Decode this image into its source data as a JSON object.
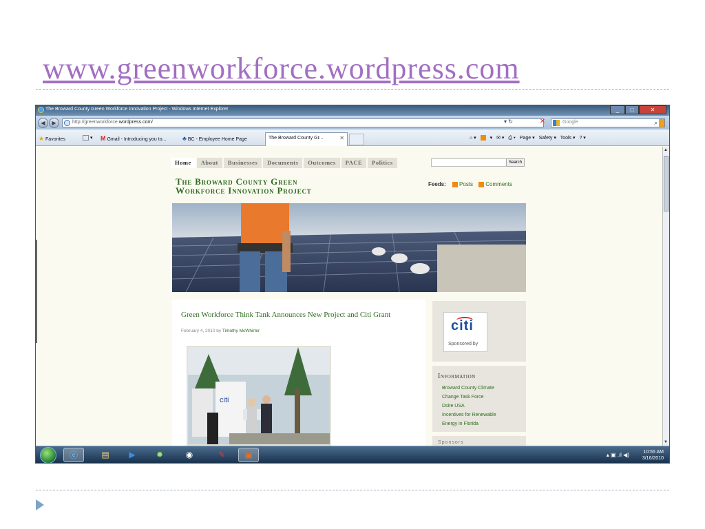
{
  "slide": {
    "title": "www.greenworkforce.wordpress.com"
  },
  "browser": {
    "window_title": "The Broward County Green Workforce Innovation Project - Windows Internet Explorer",
    "address_prefix": "http://greenworkforce.",
    "address_domain": "wordpress.com",
    "address_suffix": "/",
    "search_placeholder": "Google",
    "favorites_label": "Favorites",
    "favorites": [
      "Gmail - Introducing you to...",
      "BC - Employee Home Page"
    ],
    "active_tab": "The Broward County Gr...",
    "commands": [
      "Page ▾",
      "Safety ▾",
      "Tools ▾"
    ]
  },
  "site": {
    "nav": [
      "Home",
      "About",
      "Businesses",
      "Documents",
      "Outcomes",
      "PACE",
      "Politics"
    ],
    "search_button": "Search",
    "title_line1": "The Broward County Green",
    "title_line2": "Workforce Innovation Project",
    "feeds_label": "Feeds:",
    "feed_posts": "Posts",
    "feed_comments": "Comments",
    "post_title": "Green Workforce Think Tank Announces New Project and Citi Grant",
    "post_date": "February 4, 2010 by",
    "post_author": "Timothy McWhirter",
    "citi_logo": "citi",
    "sponsored_label": "Sponsored by",
    "info_heading": "Information",
    "info_links": [
      "Broward County Climate",
      "Change Task Force",
      "Dsire USA",
      "Incentives for Renewable",
      "Energy in Florida"
    ],
    "next_heading": "Sponsors"
  },
  "taskbar": {
    "time": "10:55 AM",
    "date": "3/16/2010"
  },
  "colors": {
    "slide_title": "#a26fc3",
    "site_green": "#2e6b1f",
    "ie_titlebar": "#3a5c7e"
  }
}
